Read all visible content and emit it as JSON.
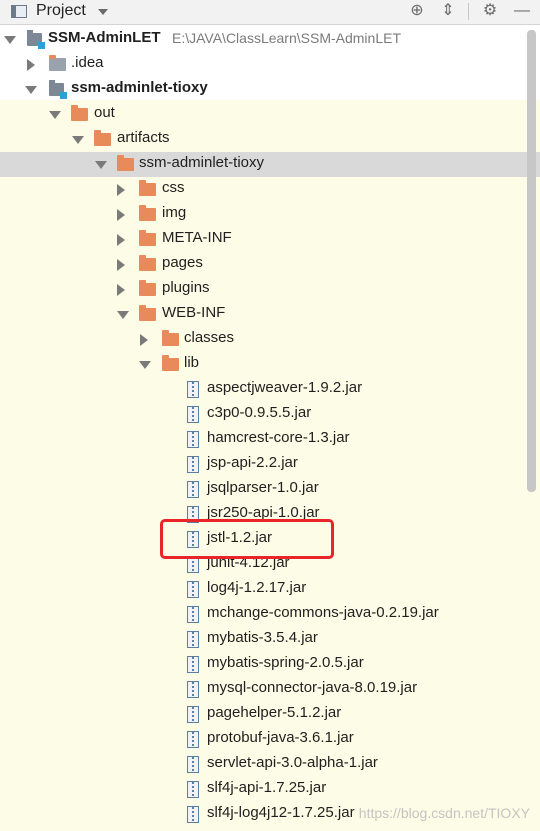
{
  "header": {
    "title": "Project",
    "buttons": [
      "target-icon",
      "collapse-icon",
      "gear-icon",
      "minimize-icon"
    ]
  },
  "tree": {
    "root": {
      "label": "SSM-AdminLET",
      "path": "E:\\JAVA\\ClassLearn\\SSM-AdminLET"
    },
    "idea": {
      "label": ".idea"
    },
    "module": {
      "label": "ssm-adminlet-tioxy"
    },
    "out": {
      "label": "out"
    },
    "artifacts": {
      "label": "artifacts"
    },
    "artifact": {
      "label": "ssm-adminlet-tioxy"
    },
    "css": {
      "label": "css"
    },
    "img": {
      "label": "img"
    },
    "metainf": {
      "label": "META-INF"
    },
    "pages": {
      "label": "pages"
    },
    "plugins": {
      "label": "plugins"
    },
    "webinf": {
      "label": "WEB-INF"
    },
    "classes": {
      "label": "classes"
    },
    "lib": {
      "label": "lib"
    },
    "jars": [
      "aspectjweaver-1.9.2.jar",
      "c3p0-0.9.5.5.jar",
      "hamcrest-core-1.3.jar",
      "jsp-api-2.2.jar",
      "jsqlparser-1.0.jar",
      "jsr250-api-1.0.jar",
      "jstl-1.2.jar",
      "junit-4.12.jar",
      "log4j-1.2.17.jar",
      "mchange-commons-java-0.2.19.jar",
      "mybatis-3.5.4.jar",
      "mybatis-spring-2.0.5.jar",
      "mysql-connector-java-8.0.19.jar",
      "pagehelper-5.1.2.jar",
      "protobuf-java-3.6.1.jar",
      "servlet-api-3.0-alpha-1.jar",
      "slf4j-api-1.7.25.jar",
      "slf4j-log4j12-1.7.25.jar"
    ]
  },
  "watermark": "https://blog.csdn.net/TIOXY",
  "colors": {
    "highlight_row": "#d9d9d9",
    "excluded_bg": "#fdfce6",
    "folder": "#e98a5b",
    "annotation_box": "#e8262a"
  }
}
